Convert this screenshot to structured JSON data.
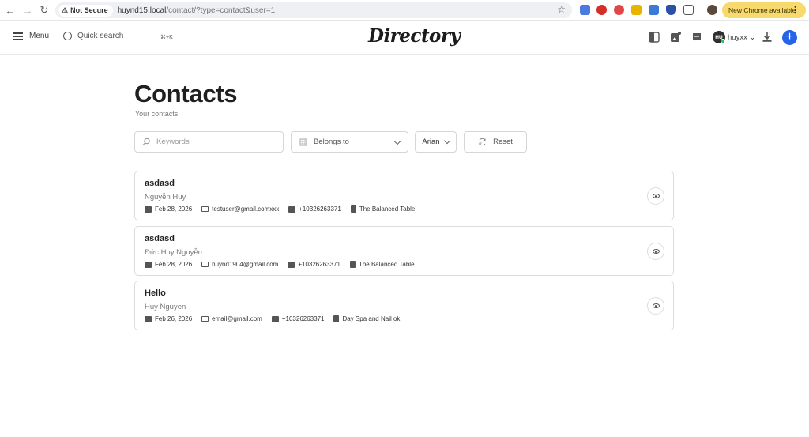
{
  "browser": {
    "not_secure_label": "Not Secure",
    "url_host": "huynd15.local",
    "url_path": "/contact/?type=contact&user=1",
    "update_label": "New Chrome available"
  },
  "header": {
    "menu_label": "Menu",
    "search_label": "Quick search",
    "shortcut": "⌘+K",
    "logo_text": "Directory",
    "avatar_initials": "HU",
    "username": "huyxx"
  },
  "page": {
    "title": "Contacts",
    "subtitle": "Your contacts"
  },
  "filters": {
    "keywords_placeholder": "Keywords",
    "belongs_to_label": "Belongs to",
    "user_label": "Arian",
    "reset_label": "Reset"
  },
  "contacts": [
    {
      "title": "asdasd",
      "name": "Nguyễn Huy",
      "date": "Feb 28, 2026",
      "email": "testuser@gmail.comxxx",
      "phone": "+10326263371",
      "business": "The Balanced Table"
    },
    {
      "title": "asdasd",
      "name": "Đức Huy Nguyễn",
      "date": "Feb 28, 2026",
      "email": "huynd1904@gmail.com",
      "phone": "+10326263371",
      "business": "The Balanced Table"
    },
    {
      "title": "Hello",
      "name": "Huy Nguyen",
      "date": "Feb 26, 2026",
      "email": "email@gmail.com",
      "phone": "+10326263371",
      "business": "Day Spa and Nail ok"
    }
  ],
  "colors": {
    "accent": "#2563eb",
    "online": "#22c55e",
    "update_button": "#f8d96e"
  }
}
